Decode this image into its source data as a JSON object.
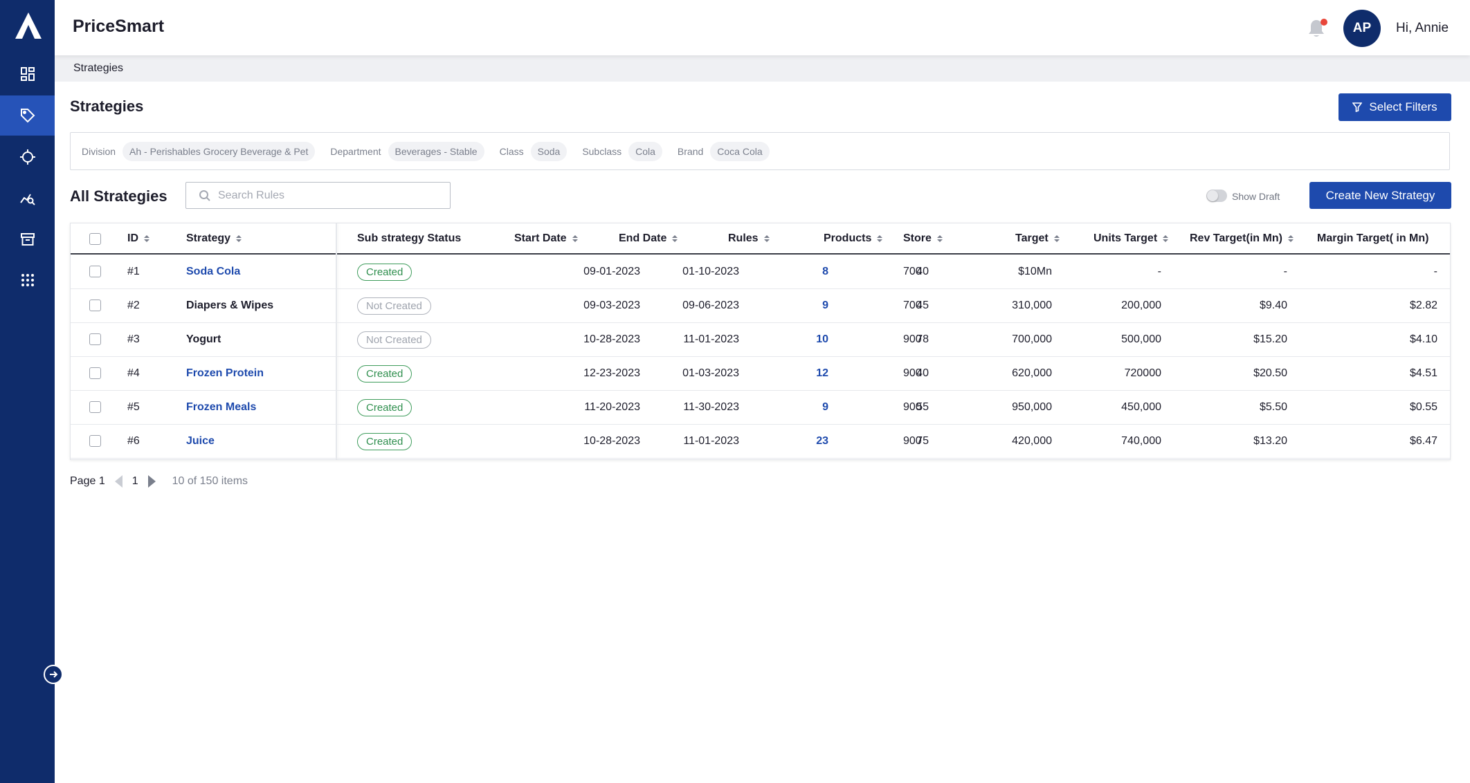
{
  "app": {
    "title": "PriceSmart"
  },
  "header": {
    "avatar_initials": "AP",
    "greeting": "Hi, Annie",
    "notification_dot_color": "#e8463a"
  },
  "sidebar": {
    "items": [
      {
        "name": "dashboard-icon",
        "active": false
      },
      {
        "name": "tag-icon",
        "active": true
      },
      {
        "name": "crosshair-icon",
        "active": false
      },
      {
        "name": "chart-search-icon",
        "active": false
      },
      {
        "name": "archive-icon",
        "active": false
      },
      {
        "name": "apps-grid-icon",
        "active": false
      }
    ]
  },
  "breadcrumb": {
    "current": "Strategies"
  },
  "page": {
    "title": "Strategies",
    "select_filters_label": "Select Filters"
  },
  "filters": [
    {
      "label": "Division",
      "value": "Ah - Perishables Grocery Beverage & Pet"
    },
    {
      "label": "Department",
      "value": "Beverages - Stable"
    },
    {
      "label": "Class",
      "value": "Soda"
    },
    {
      "label": "Subclass",
      "value": "Cola"
    },
    {
      "label": "Brand",
      "value": "Coca Cola"
    }
  ],
  "strategies": {
    "title": "All Strategies",
    "search_placeholder": "Search Rules",
    "show_draft_label": "Show Draft",
    "create_label": "Create New Strategy",
    "columns": {
      "id": "ID",
      "strategy": "Strategy",
      "status": "Sub strategy Status",
      "start": "Start Date",
      "end": "End Date",
      "rules": "Rules",
      "products": "Products",
      "store": "Store",
      "target": "Target",
      "units_target": "Units Target",
      "rev_target": "Rev Target(in Mn)",
      "margin_target": "Margin Target( in Mn)"
    },
    "rows": [
      {
        "id": "#1",
        "strategy": "Soda Cola",
        "linked": true,
        "status": "Created",
        "start": "09-01-2023",
        "end": "01-10-2023",
        "rules": "8",
        "products": "40",
        "store": "700",
        "target": "$10Mn",
        "units_target": "-",
        "rev_target": "-",
        "margin_target": "-"
      },
      {
        "id": "#2",
        "strategy": "Diapers & Wipes",
        "linked": false,
        "status": "Not Created",
        "start": "09-03-2023",
        "end": "09-06-2023",
        "rules": "9",
        "products": "45",
        "store": "700",
        "target": "310,000",
        "units_target": "200,000",
        "rev_target": "$9.40",
        "margin_target": "$2.82"
      },
      {
        "id": "#3",
        "strategy": "Yogurt",
        "linked": false,
        "status": "Not Created",
        "start": "10-28-2023",
        "end": "11-01-2023",
        "rules": "10",
        "products": "78",
        "store": "900",
        "target": "700,000",
        "units_target": "500,000",
        "rev_target": "$15.20",
        "margin_target": "$4.10"
      },
      {
        "id": "#4",
        "strategy": "Frozen Protein",
        "linked": true,
        "status": "Created",
        "start": "12-23-2023",
        "end": "01-03-2023",
        "rules": "12",
        "products": "40",
        "store": "900",
        "target": "620,000",
        "units_target": "720000",
        "rev_target": "$20.50",
        "margin_target": "$4.51"
      },
      {
        "id": "#5",
        "strategy": "Frozen Meals",
        "linked": true,
        "status": "Created",
        "start": "11-20-2023",
        "end": "11-30-2023",
        "rules": "9",
        "products": "55",
        "store": "900",
        "target": "950,000",
        "units_target": "450,000",
        "rev_target": "$5.50",
        "margin_target": "$0.55"
      },
      {
        "id": "#6",
        "strategy": "Juice",
        "linked": true,
        "status": "Created",
        "start": "10-28-2023",
        "end": "11-01-2023",
        "rules": "23",
        "products": "75",
        "store": "900",
        "target": "420,000",
        "units_target": "740,000",
        "rev_target": "$13.20",
        "margin_target": "$6.47"
      }
    ]
  },
  "pagination": {
    "page_label": "Page 1",
    "current": "1",
    "summary": "10 of 150 items"
  },
  "colors": {
    "sidebar": "#0f2c6b",
    "accent": "#1e4aad",
    "active_nav": "#2653b8",
    "created": "#2f8f4e",
    "not_created": "#9ea3ad"
  }
}
